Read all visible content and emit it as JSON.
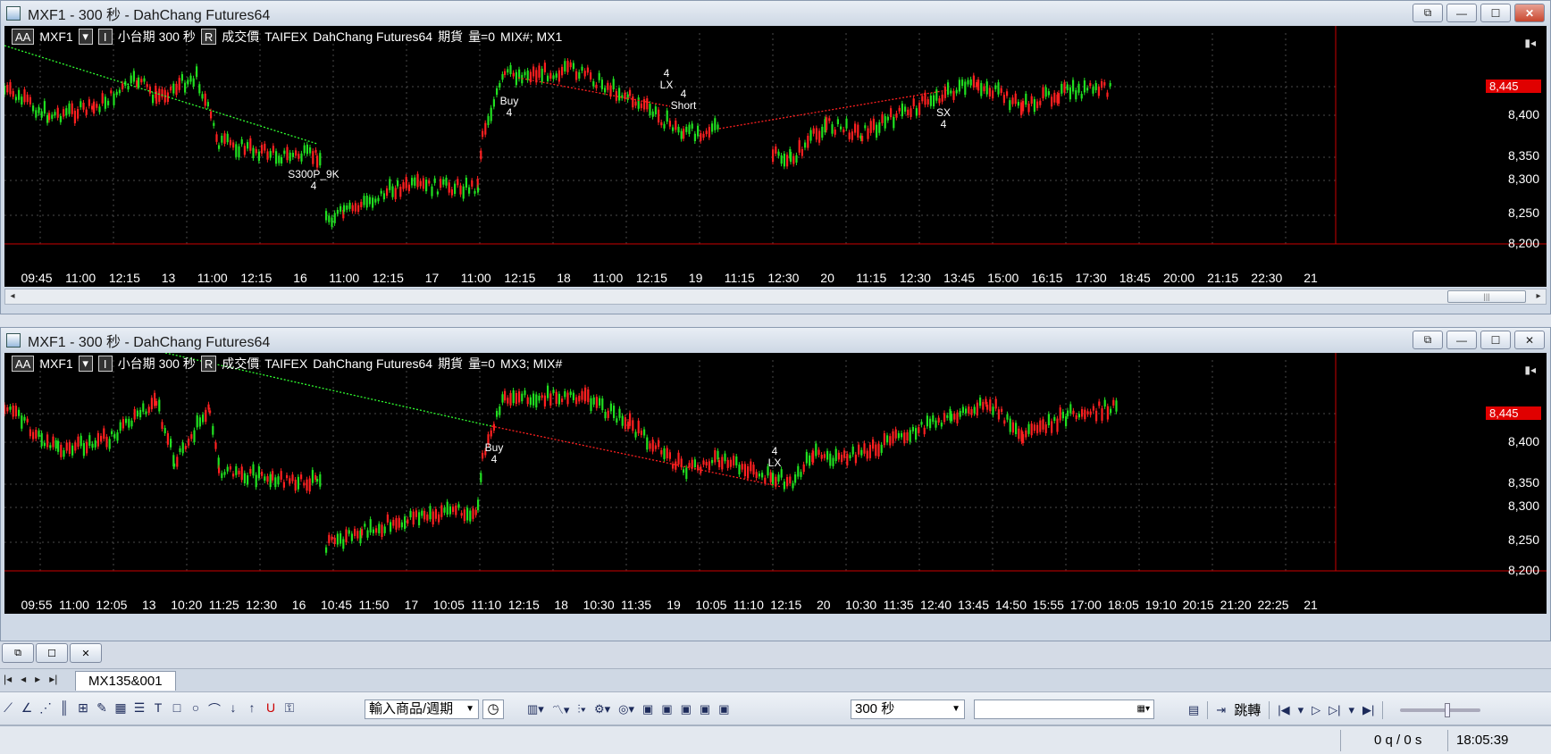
{
  "windows": [
    {
      "id": "win1",
      "title": "MXF1 - 300 秒 - DahChang Futures64",
      "header": {
        "aa": "AA",
        "symbol": "MXF1",
        "period": "小台期  300 秒",
        "r": "R",
        "field": "成交價",
        "exchange": "TAIFEX",
        "source": "DahChang Futures64",
        "type": "期貨",
        "volume": "量=0",
        "tags": "MIX#; MX1"
      },
      "price_labels": [
        "8,445",
        "8,400",
        "8,350",
        "8,300",
        "8,250",
        "8,200"
      ],
      "current_price": "8,445",
      "time_labels": [
        "09:45",
        "11:00",
        "12:15",
        "13",
        "11:00",
        "12:15",
        "16",
        "11:00",
        "12:15",
        "17",
        "11:00",
        "12:15",
        "18",
        "11:00",
        "12:15",
        "19",
        "11:15",
        "12:30",
        "20",
        "11:15",
        "12:30",
        "13:45",
        "15:00",
        "16:15",
        "17:30",
        "18:45",
        "20:00",
        "21:15",
        "22:30",
        "21"
      ],
      "markers": [
        {
          "text": "S300P_9K",
          "qty": "4"
        },
        {
          "text": "Buy",
          "qty": "4"
        },
        {
          "text": "LX",
          "qty": "4"
        },
        {
          "text": "Short",
          "qty": "4"
        },
        {
          "text": "SX",
          "qty": "4"
        }
      ],
      "scroll_thumb": "|||"
    },
    {
      "id": "win2",
      "title": "MXF1 - 300 秒 - DahChang Futures64",
      "header": {
        "aa": "AA",
        "symbol": "MXF1",
        "period": "小台期  300 秒",
        "r": "R",
        "field": "成交價",
        "exchange": "TAIFEX",
        "source": "DahChang Futures64",
        "type": "期貨",
        "volume": "量=0",
        "tags": "MX3; MIX#"
      },
      "price_labels": [
        "8,445",
        "8,400",
        "8,350",
        "8,300",
        "8,250",
        "8,200"
      ],
      "current_price": "8,445",
      "time_labels": [
        "09:55",
        "11:00",
        "12:05",
        "13",
        "10:20",
        "11:25",
        "12:30",
        "16",
        "10:45",
        "11:50",
        "17",
        "10:05",
        "11:10",
        "12:15",
        "18",
        "10:30",
        "11:35",
        "19",
        "10:05",
        "11:10",
        "12:15",
        "20",
        "10:30",
        "11:35",
        "12:40",
        "13:45",
        "14:50",
        "15:55",
        "17:00",
        "18:05",
        "19:10",
        "20:15",
        "21:20",
        "22:25",
        "21"
      ],
      "markers": [
        {
          "text": "Buy",
          "qty": "4"
        },
        {
          "text": "LX",
          "qty": "4"
        }
      ]
    }
  ],
  "tab": {
    "label": "MX135&001"
  },
  "toolbar": {
    "symbol_select": "輸入商品/週期",
    "period_select": "300 秒",
    "jump_label": "跳轉"
  },
  "status": {
    "queue": "0 q / 0 s",
    "clock": "18:05:39"
  },
  "colors": {
    "up": "#ff2020",
    "down": "#20e020",
    "bg": "#000000",
    "grid": "#4a4a4a",
    "trend_up": "#30ff30",
    "trend_down": "#ff2020"
  }
}
